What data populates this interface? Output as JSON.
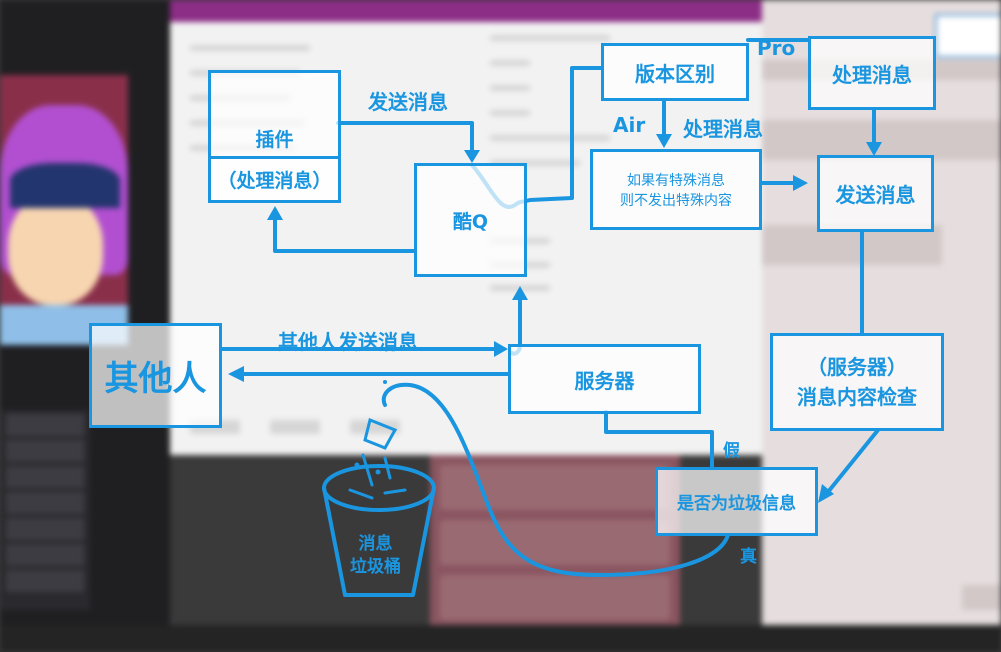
{
  "nodes": {
    "plugin": "插件",
    "plugin_handle": "（处理消息）",
    "kuq": "酷Q",
    "version_diff": "版本区别",
    "pro_handle": "处理消息",
    "special": "如果有特殊消息\n则不发出特殊内容",
    "send_msg": "发送消息",
    "others": "其他人",
    "server": "服务器",
    "server_check": "（服务器）\n消息内容检查",
    "is_spam": "是否为垃圾信息",
    "trash": "消息\n垃圾桶"
  },
  "labels": {
    "send_msg_label": "发送消息",
    "pro": "Pro",
    "air": "Air",
    "air_handle": "处理消息",
    "others_send": "其他人发送消息",
    "false": "假",
    "true": "真"
  },
  "colors": {
    "accent": "#1a96e0"
  }
}
